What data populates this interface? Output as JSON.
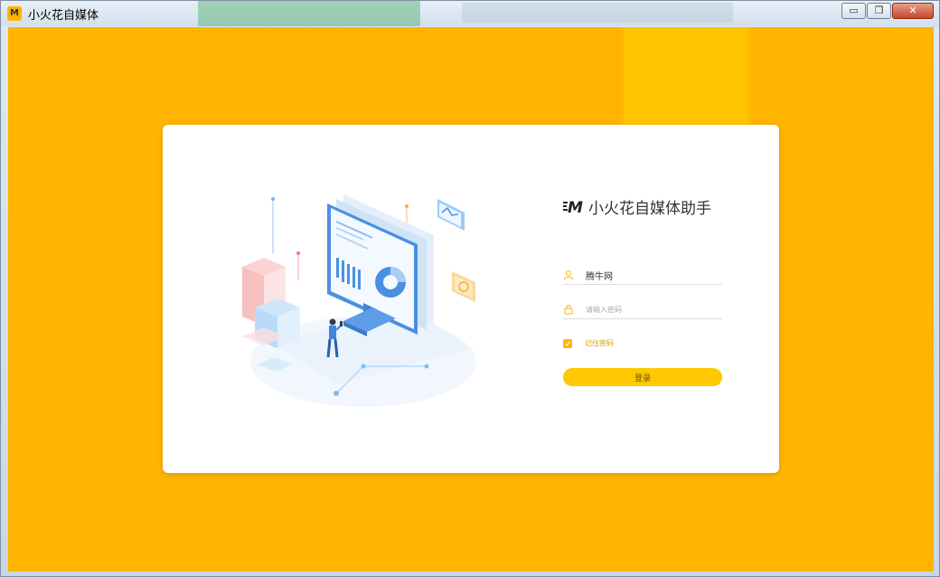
{
  "window": {
    "title": "小火花自媒体",
    "app_icon_letter": "M",
    "controls": {
      "minimize": "▭",
      "maximize": "❐",
      "close": "✕"
    }
  },
  "login": {
    "brand_logo_letter": "M",
    "brand_name": "小火花自媒体助手",
    "username": {
      "value": "腾牛网",
      "icon": "user-icon"
    },
    "password": {
      "placeholder": "请输入密码",
      "icon": "lock-icon"
    },
    "remember": {
      "label": "记住密码",
      "checked": true
    },
    "submit_label": "登录"
  },
  "colors": {
    "background": "#ffb400",
    "button": "#ffc800",
    "accent_text": "#e29b00",
    "illustration_blue": "#4a90e2"
  }
}
